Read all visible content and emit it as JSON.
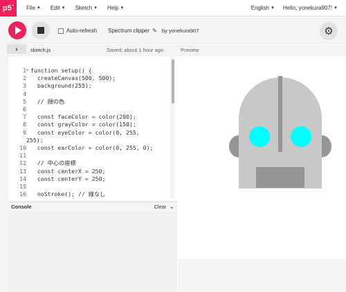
{
  "nav": {
    "logo": "p5",
    "logo_sup": "*",
    "menu": [
      {
        "label": "File"
      },
      {
        "label": "Edit"
      },
      {
        "label": "Sketch"
      },
      {
        "label": "Help"
      }
    ],
    "language": "English",
    "user": "Hello, yonekura907!"
  },
  "toolbar": {
    "autorefresh_label": "Auto-refresh",
    "sketch_name": "Spectrum clipper",
    "author": "by yonekura907"
  },
  "filebar": {
    "file_name": "sketch.js",
    "saved": "Saved: about 1 hour ago",
    "preview_label": "Preview"
  },
  "editor": {
    "lines": [
      {
        "n": "1",
        "text": "function setup() {"
      },
      {
        "n": "2",
        "text": "  createCanvas(500, 500);"
      },
      {
        "n": "3",
        "text": "  background(255);"
      },
      {
        "n": "4",
        "text": ""
      },
      {
        "n": "5",
        "text": "  // 顔の色"
      },
      {
        "n": "6",
        "text": ""
      },
      {
        "n": "7",
        "text": "  const faceColor = color(200);"
      },
      {
        "n": "8",
        "text": "  const grayColor = color(150);"
      },
      {
        "n": "9",
        "text": "  const eyeColor = color(0, 255,"
      },
      {
        "n": "",
        "text": "255);"
      },
      {
        "n": "10",
        "text": "  const earColor = color(0, 255, 0);"
      },
      {
        "n": "11",
        "text": ""
      },
      {
        "n": "12",
        "text": "  // 中心の座標"
      },
      {
        "n": "13",
        "text": "  const centerX = 250;"
      },
      {
        "n": "14",
        "text": "  const centerY = 250;"
      },
      {
        "n": "15",
        "text": ""
      },
      {
        "n": "16",
        "text": "  noStroke(); // 線なし"
      }
    ]
  },
  "console": {
    "title": "Console",
    "clear": "Clear"
  },
  "colors": {
    "accent": "#ed225d",
    "face": "#c8c8c8",
    "gray": "#969696",
    "eye": "#00ffff"
  }
}
